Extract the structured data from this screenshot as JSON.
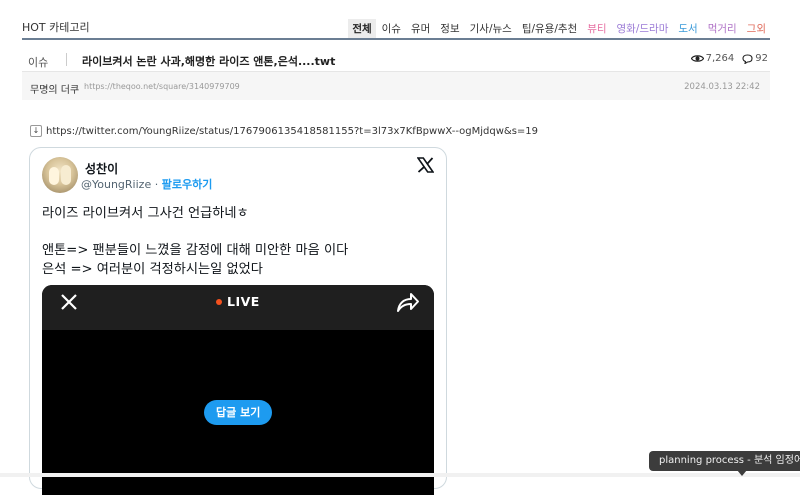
{
  "header": {
    "title": "HOT 카테고리",
    "categories": [
      {
        "label": "전체",
        "color": "#222222",
        "active": true
      },
      {
        "label": "이슈",
        "color": "#333333"
      },
      {
        "label": "유머",
        "color": "#333333"
      },
      {
        "label": "정보",
        "color": "#333333"
      },
      {
        "label": "기사/뉴스",
        "color": "#333333"
      },
      {
        "label": "팁/유용/추천",
        "color": "#333333"
      },
      {
        "label": "뷰티",
        "color": "#e76fa2"
      },
      {
        "label": "영화/드라마",
        "color": "#9b7bd6"
      },
      {
        "label": "도서",
        "color": "#3a9ad9"
      },
      {
        "label": "먹거리",
        "color": "#b073c7"
      },
      {
        "label": "그외",
        "color": "#e06b5b"
      }
    ]
  },
  "post": {
    "category": "이슈",
    "title": "라이브켜서 논란 사과,해명한 라이즈 앤톤,은석....twt",
    "views": "7,264",
    "comments": "92",
    "author": "무명의 더쿠",
    "url": "https://theqoo.net/square/3140979709",
    "date": "2024.03.13 22:42"
  },
  "link": {
    "url": "https://twitter.com/YoungRiize/status/1767906135418581155?t=3l73x7KfBpwwX--ogMjdqw&s=19"
  },
  "tweet": {
    "name": "성찬이",
    "handle": "@YoungRiize",
    "separator": "·",
    "follow": "팔로우하기",
    "line1": "라이즈 라이브켜서 그사건 언급하네ㅎ",
    "line2": "앤톤=> 팬분들이 느꼈을 감정에 대해 미안한 마음 이다",
    "line3": "은석 => 여러분이 걱정하시는일 없었다",
    "live_label": "LIVE",
    "reply_label": "답글 보기",
    "icons": {
      "close": "close-icon",
      "share": "share-icon",
      "brand": "x-logo-icon"
    }
  },
  "tooltip": {
    "text": "planning process - 분석 임정어 - 기"
  }
}
